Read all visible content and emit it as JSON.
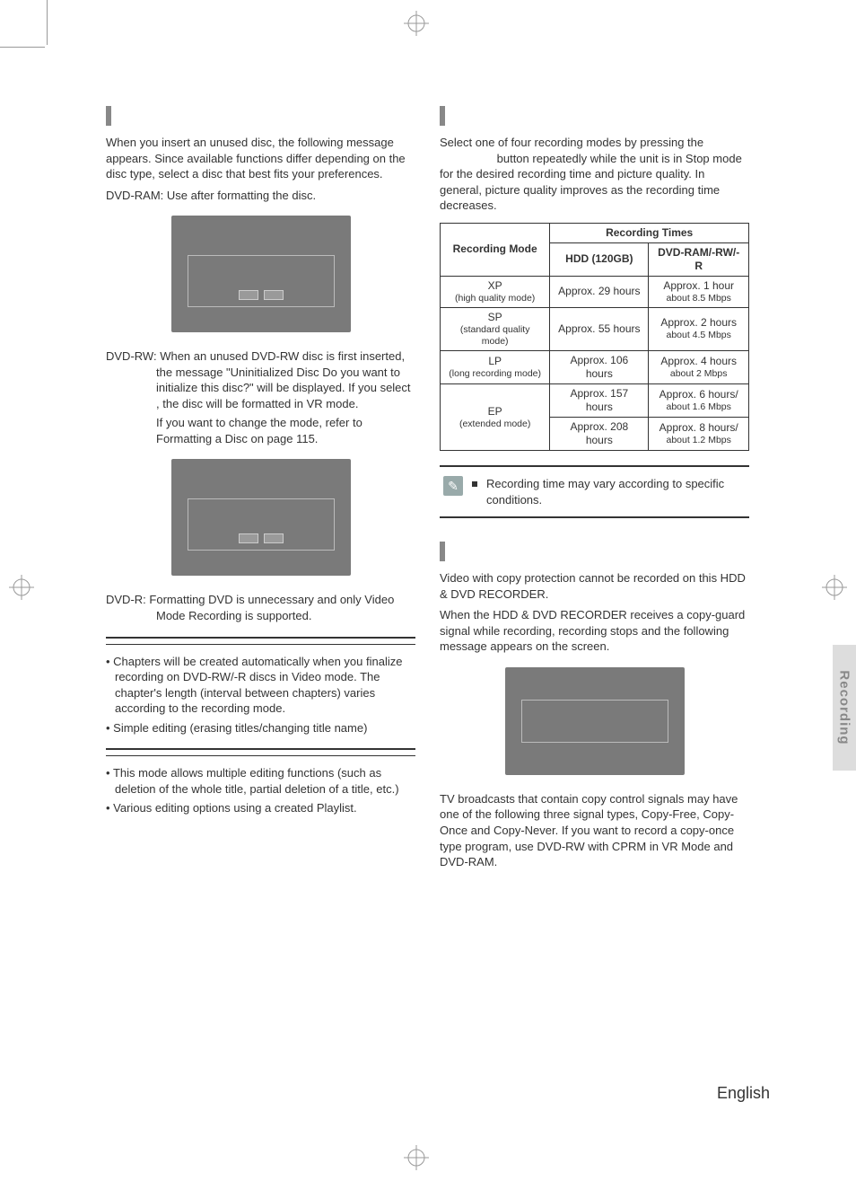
{
  "left": {
    "intro": "When you insert an unused disc, the following message appears. Since available functions differ depending on the disc type, select a disc that best fits your preferences.",
    "dvdram": "DVD-RAM: Use after formatting the disc.",
    "dvdrw_label": "DVD-RW:",
    "dvdrw1": "When an unused DVD-RW disc is first inserted, the message \"Uninitialized Disc Do you want to initialize this disc?\" will be displayed. If you select     , the disc will be formatted in VR mode.",
    "dvdrw2": "If you want to change the mode, refer to Formatting a Disc on page 115.",
    "dvdr_label": "DVD-R:",
    "dvdr": "Formatting DVD is unnecessary and only Video Mode Recording is supported.",
    "video_b1": "Chapters will be created automatically when you finalize recording on DVD-RW/-R discs in Video mode. The chapter's length (interval between chapters) varies according to the recording mode.",
    "video_b2": "Simple editing (erasing titles/changing title name)",
    "vr_b1": "This mode allows multiple editing functions (such as deletion of the whole title, partial deletion of a title, etc.)",
    "vr_b2": "Various editing options using a created Playlist."
  },
  "right": {
    "intro1": "Select one of four recording modes by pressing the",
    "intro2": "button repeatedly while the unit is in Stop mode for the desired recording time and picture quality. In general, picture quality improves as the recording time decreases.",
    "note": "Recording time may vary according to specific conditions.",
    "copy1": "Video with copy protection cannot be recorded on this HDD & DVD RECORDER.",
    "copy2": "When the HDD & DVD RECORDER receives a copy-guard signal while recording, recording stops and the following message appears on the screen.",
    "copy3": "TV broadcasts that contain copy control signals may have one of the following three signal types, Copy-Free, Copy-Once and Copy-Never. If you want to record a copy-once type program, use DVD-RW with CPRM in VR Mode and DVD-RAM."
  },
  "table": {
    "h_mode": "Recording Mode",
    "h_times": "Recording Times",
    "h_hdd": "HDD (120GB)",
    "h_dvd": "DVD-RAM/-RW/-R",
    "rows": [
      {
        "m": "XP",
        "ms": "(high quality mode)",
        "hdd": "Approx. 29 hours",
        "dvd": "Approx. 1 hour",
        "dvds": "about 8.5 Mbps"
      },
      {
        "m": "SP",
        "ms": "(standard quality mode)",
        "hdd": "Approx. 55 hours",
        "dvd": "Approx. 2 hours",
        "dvds": "about 4.5 Mbps"
      },
      {
        "m": "LP",
        "ms": "(long recording mode)",
        "hdd": "Approx. 106 hours",
        "dvd": "Approx. 4 hours",
        "dvds": "about 2 Mbps"
      }
    ],
    "ep": {
      "m": "EP",
      "ms": "(extended mode)",
      "hdd1": "Approx. 157 hours",
      "dvd1": "Approx. 6 hours/",
      "dvds1": "about 1.6 Mbps",
      "hdd2": "Approx. 208 hours",
      "dvd2": "Approx. 8 hours/",
      "dvds2": "about 1.2 Mbps"
    }
  },
  "side": "Recording",
  "lang": "English"
}
